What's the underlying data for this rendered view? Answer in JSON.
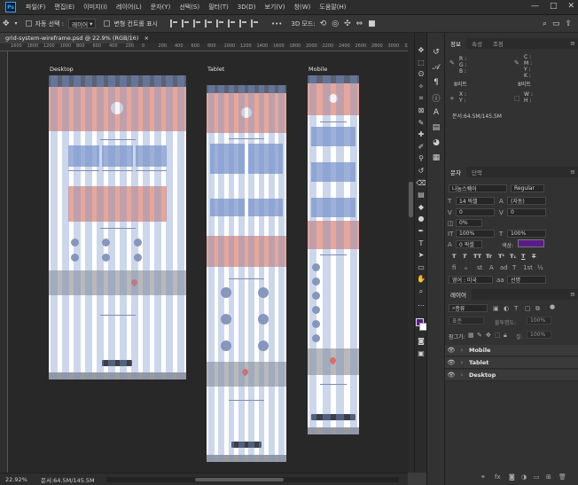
{
  "menubar": {
    "app_icon": "Ps",
    "items": [
      "파일(F)",
      "편집(E)",
      "이미지(I)",
      "레이어(L)",
      "문자(Y)",
      "선택(S)",
      "필터(T)",
      "3D(D)",
      "보기(V)",
      "창(W)",
      "도움말(H)"
    ],
    "window_controls": [
      "—",
      "□",
      "✕"
    ]
  },
  "options": {
    "move_icon": "move-tool-icon",
    "auto_select_label": "자동 선택 :",
    "auto_select_value": "레이어",
    "transform_label": "변형 컨트롤 표시",
    "more_glyph": "•••",
    "mode_3d_label": "3D 모드:"
  },
  "document": {
    "tab_title": "grid-system-wireframe.psd @ 22.9% (RGB/16)",
    "close_glyph": "×"
  },
  "rulers": {
    "top": [
      "1600",
      "1800",
      "1200",
      "1000",
      "800",
      "600",
      "400",
      "200",
      "0",
      "200",
      "400",
      "600",
      "800",
      "1000",
      "1200",
      "1400",
      "1600",
      "1800",
      "2000",
      "2200",
      "2400",
      "2600",
      "2800",
      "3000",
      "3200"
    ]
  },
  "artboards": {
    "desktop_label": "Desktop",
    "tablet_label": "Tablet",
    "mobile_label": "Mobile"
  },
  "status": {
    "zoom": "22.92%",
    "doc_info": "문서:64.5M/145.5M"
  },
  "panels": {
    "info_tabs": [
      "정보",
      "속성",
      "조정"
    ],
    "info": {
      "rgb_labels": [
        "R :",
        "G :",
        "B :"
      ],
      "cmyk_labels": [
        "C :",
        "M :",
        "Y :",
        "K :"
      ],
      "bit_left": "8비트",
      "bit_right": "8비트",
      "xy_labels": [
        "X :",
        "Y :"
      ],
      "wh_labels": [
        "W :",
        "H :"
      ],
      "doc_info": "문서:64.5M/145.5M"
    },
    "char_tabs": [
      "문자",
      "단락"
    ],
    "character": {
      "font_family": "나눔스퀘어",
      "font_style": "Regular",
      "font_size": "14 픽셀",
      "leading": "(자동)",
      "kerning": "0",
      "tracking": "0",
      "scale_pct": "0%",
      "vert_scale": "100%",
      "horiz_scale": "100%",
      "baseline": "0 픽셀",
      "color_label": "색상:",
      "color_hex": "#5a1a87",
      "type_buttons": [
        "T",
        "T",
        "TT",
        "Tr",
        "T¹",
        "T₁",
        "T",
        "T"
      ],
      "lang": "영어 : 미국",
      "antialias": "선명"
    },
    "layers_tab": "레이어",
    "layers": {
      "filter_label": "종류",
      "blend_mode": "표준",
      "opacity_label": "불투명도:",
      "opacity_value": "100%",
      "lock_label": "잠그기:",
      "fill_label": "칠:",
      "fill_value": "100%",
      "items": [
        "Mobile",
        "Tablet",
        "Desktop"
      ]
    }
  },
  "colors": {
    "foreground": "#5a1a87",
    "background": "#ffffff"
  }
}
